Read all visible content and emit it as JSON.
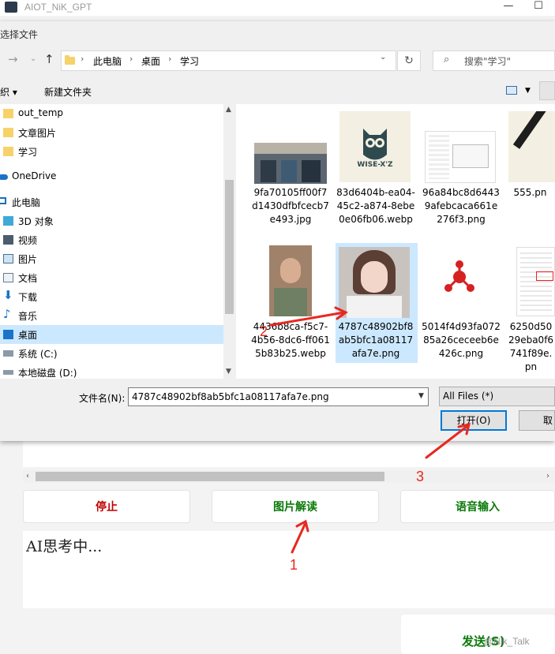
{
  "app": {
    "title": "AIOT_NiK_GPT",
    "buttons": {
      "stop": "停止",
      "image_interpret": "图片解读",
      "voice_input": "语音输入",
      "send": "发送(S)"
    },
    "output_text": "AI思考中...",
    "watermark": "@Nik_Talk",
    "colors": {
      "stop": "#c00000",
      "green": "#0a7a0a"
    }
  },
  "dialog": {
    "title": "选择文件",
    "breadcrumb": [
      "此电脑",
      "桌面",
      "学习"
    ],
    "search_placeholder": "搜索\"学习\"",
    "toolbar": {
      "organize": "组织",
      "new_folder": "新建文件夹"
    },
    "nav_items": [
      {
        "label": "out_temp",
        "icon": "folder-icon"
      },
      {
        "label": "文章图片",
        "icon": "folder-icon"
      },
      {
        "label": "学习",
        "icon": "folder-icon"
      },
      {
        "label": "OneDrive",
        "icon": "cloud-icon"
      },
      {
        "label": "此电脑",
        "icon": "computer-icon"
      },
      {
        "label": "3D 对象",
        "icon": "cube-icon"
      },
      {
        "label": "视频",
        "icon": "video-icon"
      },
      {
        "label": "图片",
        "icon": "picture-icon"
      },
      {
        "label": "文档",
        "icon": "document-icon"
      },
      {
        "label": "下载",
        "icon": "download-icon"
      },
      {
        "label": "音乐",
        "icon": "music-icon"
      },
      {
        "label": "桌面",
        "icon": "desktop-icon"
      },
      {
        "label": "系统 (C:)",
        "icon": "drive-icon"
      },
      {
        "label": "本地磁盘 (D:)",
        "icon": "drive-icon"
      }
    ],
    "files": [
      {
        "name": "9fa70105ff00f7d1430dfbfcecb7e493.jpg"
      },
      {
        "name": "83d6404b-ea04-45c2-a874-8ebe0e06fb06.webp",
        "logo_text": "WISE-X'Z"
      },
      {
        "name": "96a84bc8d64439afebcaca661e276f3.png"
      },
      {
        "name": "555.pn"
      },
      {
        "name": "4436b8ca-f5c7-4b56-8dc6-ff0615b83b25.webp"
      },
      {
        "name": "4787c48902bf8ab5bfc1a08117afa7e.png"
      },
      {
        "name": "5014f4d93fa07285a26ceceeb6e426c.png"
      },
      {
        "name": "6250d5029eba0f6741f89e.pn"
      }
    ],
    "filename_label": "文件名(N):",
    "filename_value": "4787c48902bf8ab5bfc1a08117afa7e.png",
    "filetype_value": "All Files  (*)",
    "open_button": "打开(O)",
    "cancel_button": "取"
  },
  "annotations": {
    "one": "1",
    "two": "2",
    "three": "3"
  }
}
